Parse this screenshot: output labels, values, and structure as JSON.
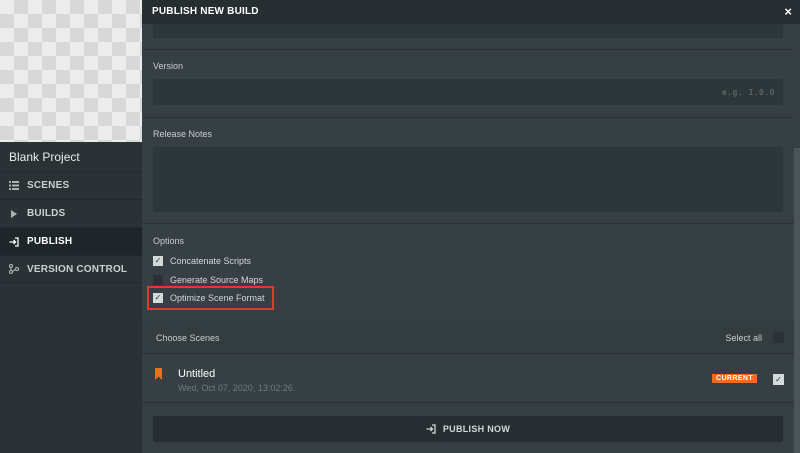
{
  "sidebar": {
    "project_name": "Blank Project",
    "items": [
      {
        "label": "SCENES",
        "icon": "list-icon"
      },
      {
        "label": "BUILDS",
        "icon": "triangle-right-icon"
      },
      {
        "label": "PUBLISH",
        "icon": "publish-icon",
        "active": true
      },
      {
        "label": "VERSION CONTROL",
        "icon": "branch-icon"
      }
    ]
  },
  "dialog": {
    "title": "PUBLISH NEW BUILD",
    "close_label": "×",
    "version_label": "Version",
    "version_placeholder": "e.g. 1.0.0",
    "release_notes_label": "Release Notes",
    "options_label": "Options",
    "options": [
      {
        "label": "Concatenate Scripts",
        "checked": true
      },
      {
        "label": "Generate Source Maps",
        "checked": false
      },
      {
        "label": "Optimize Scene Format",
        "checked": true
      }
    ],
    "choose_scenes_label": "Choose Scenes",
    "select_all_label": "Select all",
    "scenes": [
      {
        "name": "Untitled",
        "date": "Wed, Oct 07, 2020, 13:02:26",
        "badge": "CURRENT",
        "checked": true
      }
    ],
    "publish_button_label": "PUBLISH NOW"
  },
  "colors": {
    "accent": "#f26a1b",
    "highlight": "#e03a2f"
  }
}
